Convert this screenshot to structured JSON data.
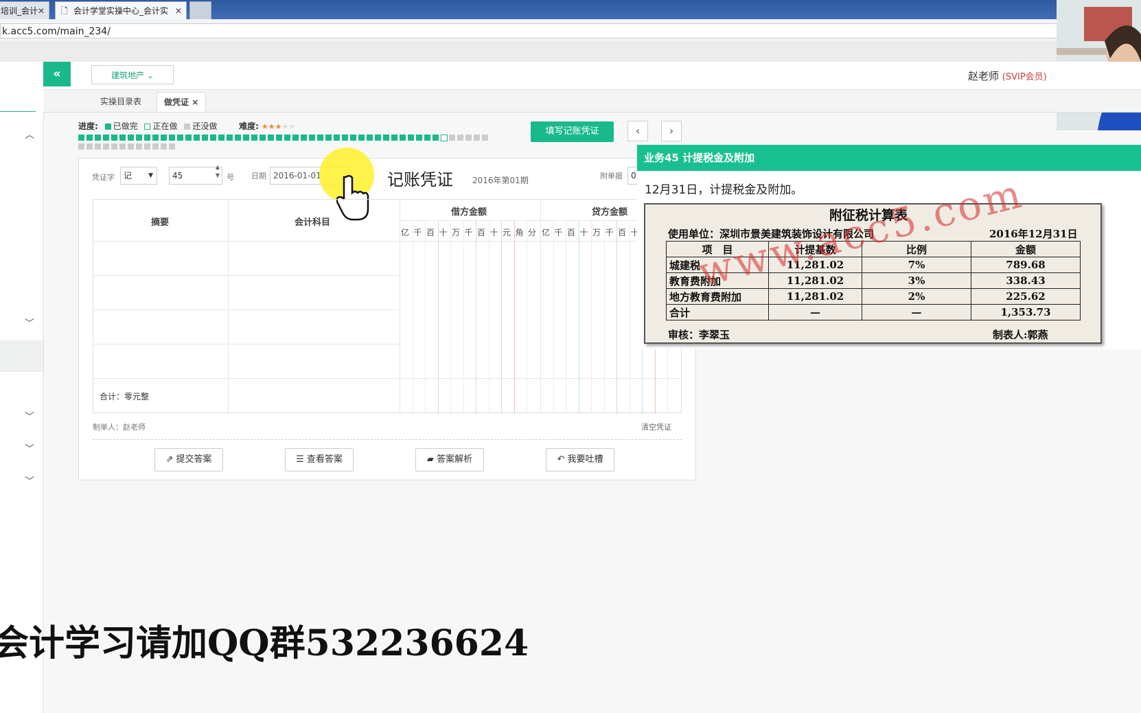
{
  "browser": {
    "tabs": [
      {
        "label": "培训_会计",
        "active": false
      },
      {
        "label": "会计学堂实操中心_会计实",
        "active": true
      }
    ],
    "url": "k.acc5.com/main_234/"
  },
  "header": {
    "collapse_icon": "«",
    "industry_select": "建筑地产",
    "user_name": "赵老师",
    "user_badge": "(SVIP会员)"
  },
  "nav_tabs": [
    {
      "label": "实操目录表",
      "active": false
    },
    {
      "label": "做凭证",
      "active": true,
      "close": "×"
    }
  ],
  "progress": {
    "label": "进度:",
    "done_label": "已做完",
    "doing_label": "正在做",
    "todo_label": "还没做",
    "difficulty_label": "难度:",
    "difficulty_stars": 3,
    "difficulty_max": 5,
    "total": 62,
    "done": 44,
    "current": 45,
    "colors": {
      "done": "#19b98c",
      "doing": "#ffffff",
      "todo": "#cccccc"
    }
  },
  "actions": {
    "fill_voucher": "填写记账凭证",
    "prev": "‹",
    "next": "›"
  },
  "voucher": {
    "word_label": "凭证字",
    "word_value": "记",
    "number_value": "45",
    "number_suffix": "号",
    "date_label": "日期",
    "date_value": "2016-01-01",
    "title": "记账凭证",
    "period": "2016年第01期",
    "attachment_label": "附单据",
    "attachment_value": "0",
    "columns": {
      "summary": "摘要",
      "account": "会计科目",
      "debit": "借方金额",
      "credit": "贷方金额"
    },
    "digit_units": [
      "亿",
      "千",
      "百",
      "十",
      "万",
      "千",
      "百",
      "十",
      "元",
      "角",
      "分"
    ],
    "credit_digit_units": [
      "亿",
      "千",
      "百",
      "十",
      "万",
      "千",
      "百",
      "十"
    ],
    "total_label": "合计：零元整",
    "preparer": "制单人：赵老师",
    "clear": "清空凭证"
  },
  "buttons": {
    "submit": "提交答案",
    "view": "查看答案",
    "analysis": "答案解析",
    "feedback": "我要吐槽"
  },
  "task": {
    "title": "业务45 计提税金及附加",
    "description": "12月31日，计提税金及附加。",
    "table_title": "附征税计算表",
    "company": "使用单位：深圳市景美建筑装饰设计有限公司",
    "date": "2016年12月31日",
    "headers": [
      "项　目",
      "计提基数",
      "比例",
      "金额"
    ],
    "rows": [
      [
        "城建税",
        "11,281.02",
        "7%",
        "789.68"
      ],
      [
        "教育费附加",
        "11,281.02",
        "3%",
        "338.43"
      ],
      [
        "地方教育费附加",
        "11,281.02",
        "2%",
        "225.62"
      ],
      [
        "合计",
        "—",
        "—",
        "1,353.73"
      ]
    ],
    "auditor": "审核：李翠玉",
    "maker": "制表人:郭燕",
    "watermark": "www.acc5.com"
  },
  "caption": "会计学习请加QQ群532236624"
}
